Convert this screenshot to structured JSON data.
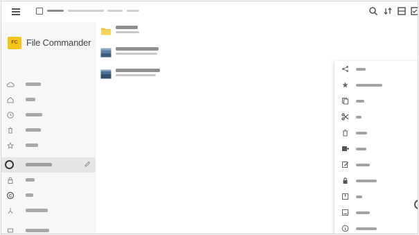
{
  "toolbar": {
    "breadcrumb": [
      "",
      "",
      "",
      ""
    ],
    "icons": [
      "search-icon",
      "sort-icon",
      "view-mode-icon",
      "select-all-icon"
    ]
  },
  "sidebar": {
    "app_title": "File Commander",
    "items": [
      {
        "label": "",
        "icon": "add-cloud-icon"
      },
      {
        "label": "",
        "icon": "home-icon"
      },
      {
        "label": "",
        "icon": "recent-files-icon"
      },
      {
        "label": "",
        "icon": "recycle-bin-icon"
      },
      {
        "label": "",
        "icon": "favorites-icon"
      },
      {
        "label": "",
        "icon": "internal-storage-icon",
        "selected": true
      },
      {
        "label": "",
        "icon": "vault-icon"
      },
      {
        "label": "",
        "icon": "convert-icon"
      },
      {
        "label": "",
        "icon": "local-network-icon"
      },
      {
        "label": "",
        "icon": "network-icon"
      }
    ]
  },
  "files": [
    {
      "name": "",
      "meta": "",
      "type": "folder"
    },
    {
      "name": "",
      "meta": "",
      "type": "image"
    },
    {
      "name": "",
      "meta": "",
      "type": "image"
    }
  ],
  "context_menu": {
    "items": [
      {
        "label": "",
        "icon": "share-icon"
      },
      {
        "label": "",
        "icon": "add-to-favorites-icon"
      },
      {
        "label": "",
        "icon": "copy-icon"
      },
      {
        "label": "",
        "icon": "cut-icon"
      },
      {
        "label": "",
        "icon": "delete-icon"
      },
      {
        "label": "",
        "icon": "move-icon"
      },
      {
        "label": "",
        "icon": "rename-icon"
      },
      {
        "label": "",
        "icon": "move-to-vault-icon"
      },
      {
        "label": "",
        "icon": "zip-icon"
      },
      {
        "label": "",
        "icon": "open-with-icon"
      },
      {
        "label": "",
        "icon": "properties-icon"
      }
    ]
  },
  "colors": {
    "accent_folder": "#f2c43d",
    "app_logo": "#f5c518",
    "selected_row": "#e6e6e6",
    "sidebar_bg": "#f7f7f7"
  }
}
